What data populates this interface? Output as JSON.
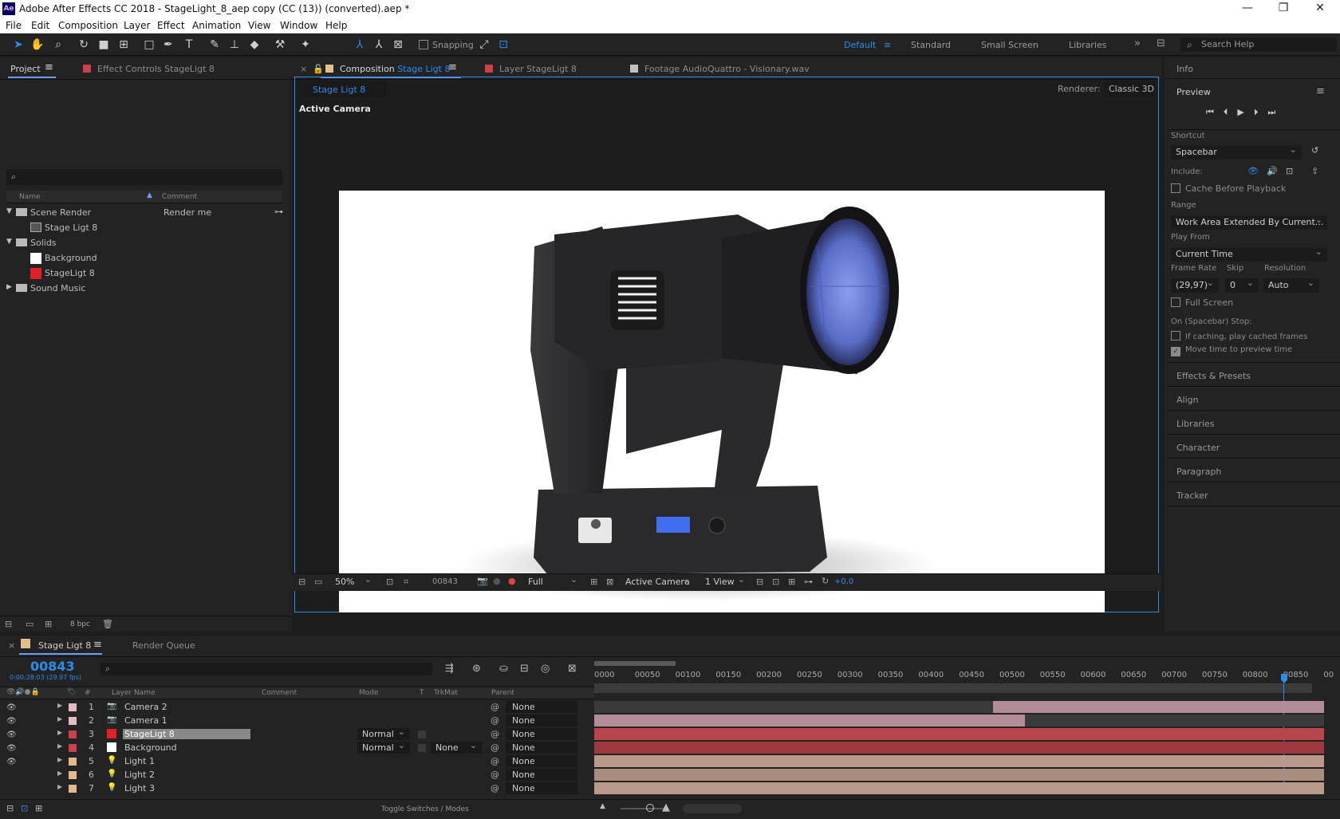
{
  "window": {
    "title": "Adobe After Effects CC 2018 - StageLight_8_aep copy (CC (13)) (converted).aep *",
    "logo": "Ae",
    "controls": [
      "minimize-icon",
      "restore-icon",
      "close-icon"
    ]
  },
  "menu": [
    "File",
    "Edit",
    "Composition",
    "Layer",
    "Effect",
    "Animation",
    "View",
    "Window",
    "Help"
  ],
  "toolbar": {
    "snapping": "Snapping",
    "workspaces": [
      "Default",
      "Standard",
      "Small Screen",
      "Libraries"
    ],
    "search_placeholder": "Search Help"
  },
  "project": {
    "tabs": [
      "Project",
      "Effect Controls StageLigt 8"
    ],
    "columns": [
      "Name",
      "Comment"
    ],
    "items": [
      {
        "name": "Scene Render",
        "comment": "Render me",
        "type": "folder",
        "level": 0
      },
      {
        "name": "Stage Ligt 8",
        "comment": "",
        "type": "comp",
        "level": 1
      },
      {
        "name": "Solids",
        "comment": "",
        "type": "folder",
        "level": 0
      },
      {
        "name": "Background",
        "comment": "",
        "type": "solid-white",
        "level": 1
      },
      {
        "name": "StageLigt 8",
        "comment": "",
        "type": "solid-red",
        "level": 1
      },
      {
        "name": "Sound Music",
        "comment": "",
        "type": "folder",
        "level": 0
      }
    ],
    "bpc": "8 bpc"
  },
  "viewer": {
    "tabs": [
      "Composition Stage Ligt 8",
      "Layer StageLigt 8",
      "Footage AudioQuattro - Visionary.wav"
    ],
    "comp_prefix": "Composition",
    "comp_name": "Stage Ligt 8",
    "subtab": "Stage Ligt 8",
    "renderer_label": "Renderer:",
    "renderer": "Classic 3D",
    "view_label": "Active Camera",
    "footer": {
      "zoom": "50%",
      "frame": "00843",
      "resolution": "Full",
      "camera": "Active Camera",
      "views": "1 View",
      "exposure": "+0,0"
    }
  },
  "right": {
    "info": "Info",
    "preview": "Preview",
    "shortcut_label": "Shortcut",
    "shortcut": "Spacebar",
    "include_label": "Include:",
    "cache": "Cache Before Playback",
    "range_label": "Range",
    "range": "Work Area Extended By Current...",
    "play_from_label": "Play From",
    "play_from": "Current Time",
    "frame_rate_label": "Frame Rate",
    "skip_label": "Skip",
    "resolution_label": "Resolution",
    "frame_rate": "(29,97)",
    "skip": "0",
    "resolution": "Auto",
    "full_screen": "Full Screen",
    "stop_label": "On (Spacebar) Stop:",
    "if_caching": "If caching, play cached frames",
    "move_time": "Move time to preview time",
    "sections": [
      "Effects & Presets",
      "Align",
      "Libraries",
      "Character",
      "Paragraph",
      "Tracker"
    ]
  },
  "timeline": {
    "tabs": [
      "Stage Ligt 8",
      "Render Queue"
    ],
    "timecode": "00843",
    "timecode_sub": "0:00:28:03 (29.97 fps)",
    "columns": [
      "Layer Name",
      "Comment",
      "Mode",
      "T",
      "TrkMat",
      "Parent"
    ],
    "ruler": [
      "0000",
      "00050",
      "00100",
      "00150",
      "00200",
      "00250",
      "00300",
      "00350",
      "00400",
      "00450",
      "00500",
      "00550",
      "00600",
      "00650",
      "00700",
      "00750",
      "00800",
      "00850",
      "00"
    ],
    "layers": [
      {
        "num": "1",
        "name": "Camera 2",
        "type": "camera",
        "color": "#e7b9c5",
        "mode": "",
        "trkmat": "",
        "parent": "None",
        "visible": true
      },
      {
        "num": "2",
        "name": "Camera 1",
        "type": "camera",
        "color": "#e7b9c5",
        "mode": "",
        "trkmat": "",
        "parent": "None",
        "visible": true
      },
      {
        "num": "3",
        "name": "StageLigt 8",
        "type": "solid",
        "color": "#c9414a",
        "mode": "Normal",
        "trkmat": "",
        "parent": "None",
        "visible": true
      },
      {
        "num": "4",
        "name": "Background",
        "type": "solid",
        "color": "#c9414a",
        "mode": "Normal",
        "trkmat": "None",
        "parent": "None",
        "visible": true
      },
      {
        "num": "5",
        "name": "Light 1",
        "type": "light",
        "color": "#e4b98f",
        "mode": "",
        "trkmat": "",
        "parent": "None",
        "visible": true
      },
      {
        "num": "6",
        "name": "Light 2",
        "type": "light",
        "color": "#e4b98f",
        "mode": "",
        "trkmat": "",
        "parent": "None",
        "visible": false
      },
      {
        "num": "7",
        "name": "Light 3",
        "type": "light",
        "color": "#e4b98f",
        "mode": "",
        "trkmat": "",
        "parent": "None",
        "visible": false
      }
    ],
    "footer": "Toggle Switches / Modes"
  },
  "colors": {
    "accent": "#2d8ceb",
    "panel": "#232323",
    "pink_bar": "#b28c96",
    "red_bar": "#b8444c",
    "tan_bar": "#b8998a"
  }
}
